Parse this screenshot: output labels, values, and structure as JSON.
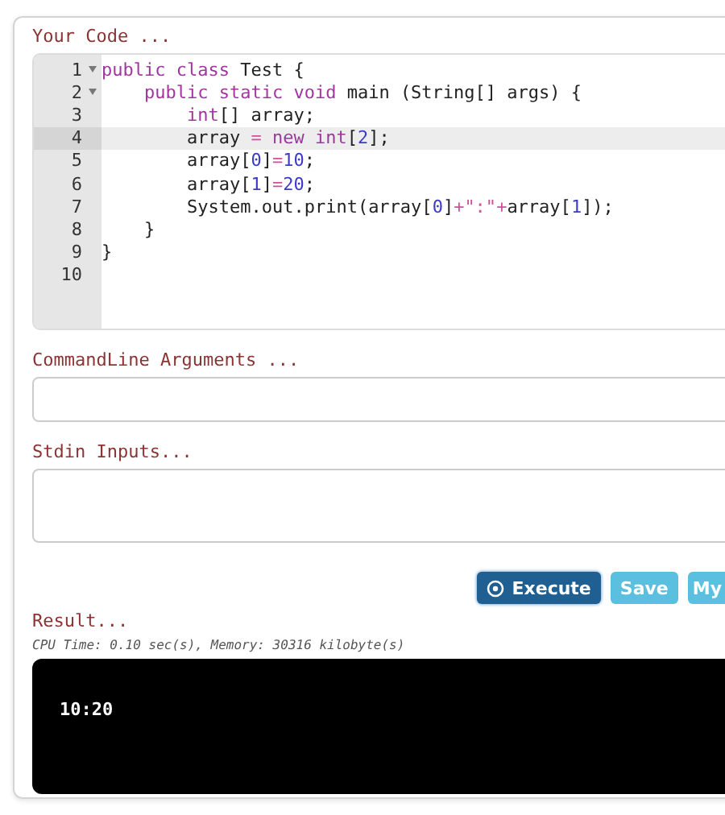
{
  "code_editor": {
    "label": "Your Code ...",
    "lines": [
      {
        "number": "1",
        "foldable": true,
        "active": false,
        "tokens": [
          {
            "t": "public class",
            "kind": "keyword"
          },
          {
            "t": " Test {",
            "kind": "plain"
          }
        ]
      },
      {
        "number": "2",
        "foldable": true,
        "active": false,
        "tokens": [
          {
            "t": "    public static void",
            "kind": "keyword"
          },
          {
            "t": " main (String[] args) {",
            "kind": "plain"
          }
        ]
      },
      {
        "number": "3",
        "foldable": false,
        "active": false,
        "tokens": [
          {
            "t": "        int",
            "kind": "keyword"
          },
          {
            "t": "[] array;",
            "kind": "plain"
          }
        ]
      },
      {
        "number": "4",
        "foldable": false,
        "active": true,
        "tokens": [
          {
            "t": "        array ",
            "kind": "plain"
          },
          {
            "t": "=",
            "kind": "operator"
          },
          {
            "t": " new int",
            "kind": "keyword"
          },
          {
            "t": "[",
            "kind": "plain"
          },
          {
            "t": "2",
            "kind": "number"
          },
          {
            "t": "];",
            "kind": "plain"
          }
        ]
      },
      {
        "number": "5",
        "foldable": false,
        "active": false,
        "tokens": [
          {
            "t": "        array[",
            "kind": "plain"
          },
          {
            "t": "0",
            "kind": "number"
          },
          {
            "t": "]",
            "kind": "plain"
          },
          {
            "t": "=",
            "kind": "operator"
          },
          {
            "t": "10",
            "kind": "number"
          },
          {
            "t": ";",
            "kind": "plain"
          }
        ]
      },
      {
        "number": "6",
        "foldable": false,
        "active": false,
        "tokens": [
          {
            "t": "        array[",
            "kind": "plain"
          },
          {
            "t": "1",
            "kind": "number"
          },
          {
            "t": "]",
            "kind": "plain"
          },
          {
            "t": "=",
            "kind": "operator"
          },
          {
            "t": "20",
            "kind": "number"
          },
          {
            "t": ";",
            "kind": "plain"
          }
        ]
      },
      {
        "number": "7",
        "foldable": false,
        "active": false,
        "tokens": [
          {
            "t": "        System.out.print(array[",
            "kind": "plain"
          },
          {
            "t": "0",
            "kind": "number"
          },
          {
            "t": "]",
            "kind": "plain"
          },
          {
            "t": "+",
            "kind": "operator"
          },
          {
            "t": "\":\"",
            "kind": "string"
          },
          {
            "t": "+",
            "kind": "operator"
          },
          {
            "t": "array[",
            "kind": "plain"
          },
          {
            "t": "1",
            "kind": "number"
          },
          {
            "t": "]);",
            "kind": "plain"
          }
        ]
      },
      {
        "number": "8",
        "foldable": false,
        "active": false,
        "tokens": [
          {
            "t": "    }",
            "kind": "plain"
          }
        ]
      },
      {
        "number": "9",
        "foldable": false,
        "active": false,
        "tokens": [
          {
            "t": "}",
            "kind": "plain"
          }
        ]
      },
      {
        "number": "10",
        "foldable": false,
        "active": false
      }
    ]
  },
  "arguments": {
    "label": "CommandLine Arguments ..."
  },
  "stdin": {
    "label": "Stdin Inputs..."
  },
  "buttons": [
    {
      "label": "Execute",
      "kind": "primary"
    },
    {
      "label": "Save",
      "kind": "secondary"
    },
    {
      "label": "My",
      "kind": "secondary"
    }
  ],
  "result": {
    "label": "Result...",
    "stats": "CPU Time: 0.10 sec(s), Memory: 30316 kilobyte(s)",
    "output": "10:20"
  }
}
